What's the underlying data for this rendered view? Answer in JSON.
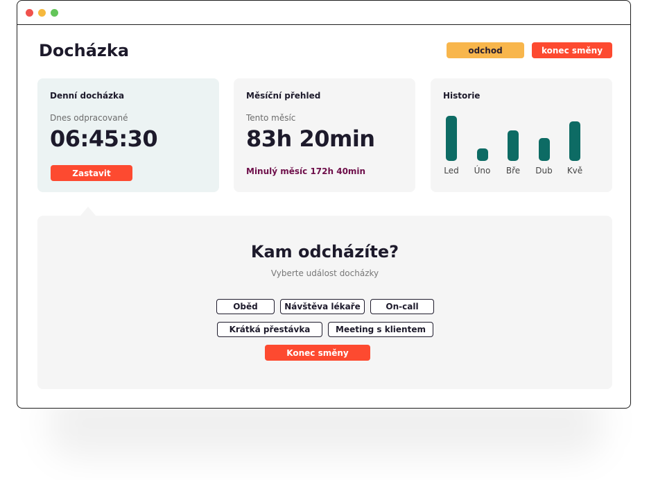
{
  "header": {
    "title": "Docházka",
    "odchod_label": "odchod",
    "konec_label": "konec směny"
  },
  "daily": {
    "title": "Denní docházka",
    "subtitle": "Dnes odpracované",
    "value": "06:45:30",
    "stop_label": "Zastavit"
  },
  "monthly": {
    "title": "Měsíční přehled",
    "subtitle": "Tento měsíc",
    "value": "83h 20min",
    "last_month": "Minulý měsíc 172h 40min"
  },
  "history": {
    "title": "Historie",
    "months": [
      {
        "label": "Led",
        "value": 1.0
      },
      {
        "label": "Úno",
        "value": 0.28
      },
      {
        "label": "Bře",
        "value": 0.68
      },
      {
        "label": "Dub",
        "value": 0.5
      },
      {
        "label": "Kvě",
        "value": 0.88
      }
    ],
    "bar_color": "#0d6b64"
  },
  "leave_panel": {
    "title": "Kam odcházíte?",
    "subtitle": "Vyberte událost docházky",
    "options": [
      "Oběd",
      "Návštěva lékaře",
      "On-call",
      "Krátká přestávka",
      "Meeting s klientem"
    ],
    "end_label": "Konec směny"
  },
  "colors": {
    "accent_red": "#fd4a30",
    "accent_yellow": "#f8b64c",
    "teal": "#0d6b64"
  }
}
